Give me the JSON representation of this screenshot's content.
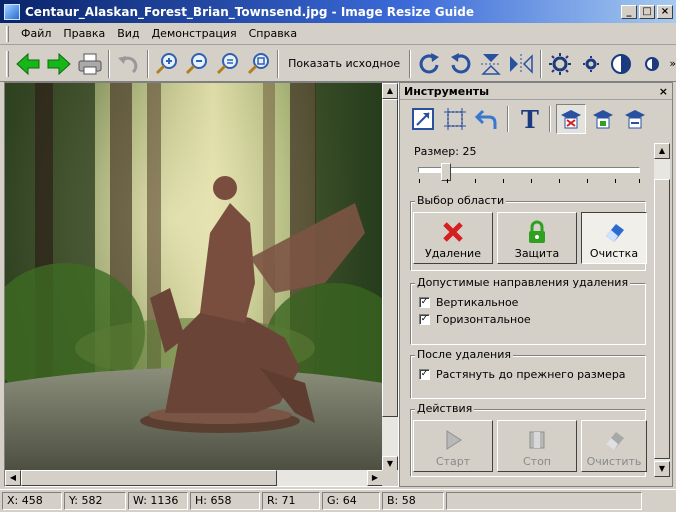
{
  "window": {
    "title": "Centaur_Alaskan_Forest_Brian_Townsend.jpg - Image Resize Guide",
    "minimize": "_",
    "maximize": "□",
    "close": "×"
  },
  "menu": [
    "Файл",
    "Правка",
    "Вид",
    "Демонстрация",
    "Справка"
  ],
  "toolbar": {
    "show_original": "Показать исходное",
    "more": "»"
  },
  "panel": {
    "title": "Инструменты",
    "close": "×",
    "size_label": "Размер: 25",
    "size_value": 25,
    "size_max": 200,
    "area_group": "Выбор области",
    "area_buttons": [
      "Удаление",
      "Защита",
      "Очистка"
    ],
    "directions_group": "Допустимые направления удаления",
    "vertical": "Вертикальное",
    "horizontal": "Горизонтальное",
    "after_group": "После удаления",
    "stretch": "Растянуть до прежнего размера",
    "actions_group": "Действия",
    "action_buttons": [
      "Старт",
      "Стоп",
      "Очистить"
    ]
  },
  "status": {
    "x": "X: 458",
    "y": "Y: 582",
    "w": "W: 1136",
    "h": "H: 658",
    "r": "R: 71",
    "g": "G: 64",
    "b": "B: 58"
  },
  "colors": {
    "title_gradient_start": "#0a246a",
    "delete_red": "#d42020",
    "protect_green": "#30a020",
    "clear_blue": "#2a6bd1",
    "arrow_green": "#19b619"
  }
}
